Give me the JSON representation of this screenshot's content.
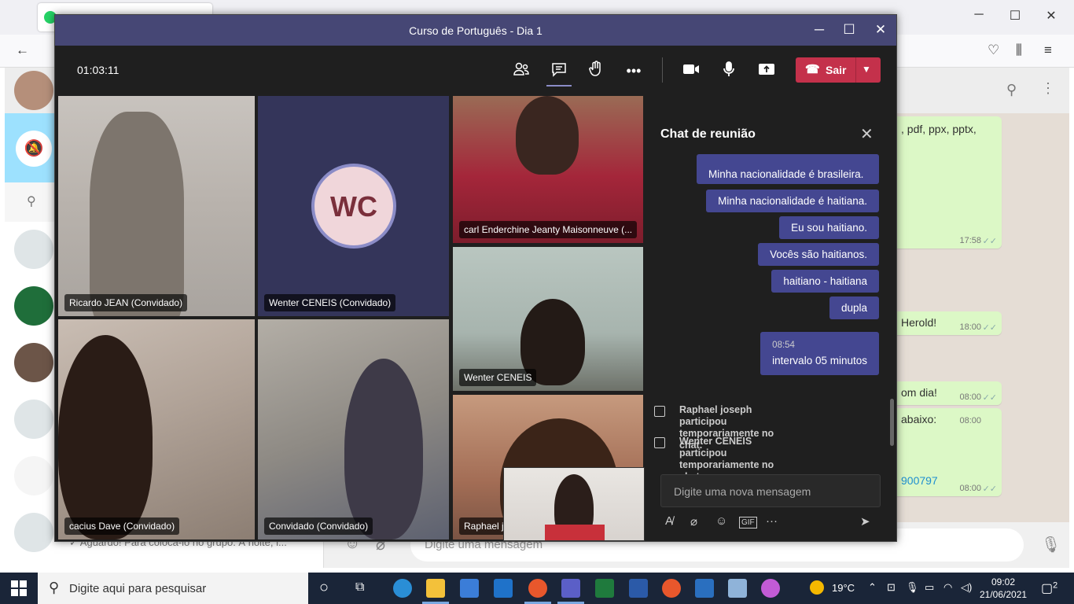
{
  "browser": {
    "wa_last_message": "✓ Aguardo! Para colocá-lo no grupo. À noite, l...",
    "wa_input_placeholder": "Digite uma mensagem",
    "wa_bubbles": [
      {
        "text": ", pdf, ppx, pptx,",
        "time": "17:58"
      },
      {
        "text": "Herold!",
        "time": "18:00"
      },
      {
        "text": "om dia!",
        "time": "08:00"
      },
      {
        "text": "abaixo:",
        "time": "08:00"
      },
      {
        "text": "900797",
        "time": "08:00"
      }
    ]
  },
  "teams": {
    "window_title": "Curso de Português - Dia 1",
    "timer": "01:03:11",
    "leave_label": "Sair",
    "participants": [
      {
        "name": "Ricardo JEAN (Convidado)"
      },
      {
        "name": "Wenter CENEIS (Convidado)",
        "initials": "WC"
      },
      {
        "name": "carl Enderchine Jeanty Maisonneuve (..."
      },
      {
        "name": "Wenter CENEIS"
      },
      {
        "name": "Raphael jo"
      },
      {
        "name": "cacius Dave (Convidado)"
      },
      {
        "name": "Convidado (Convidado)"
      }
    ],
    "chat": {
      "title": "Chat de reunião",
      "messages": [
        "Minha nacionalidade é brasileira.",
        "Minha nacionalidade é haitiana.",
        "Eu sou haitiano.",
        "Vocês são haitianos.",
        "haitiano - haitiana",
        "dupla"
      ],
      "timed_message": {
        "time": "08:54",
        "text": "intervalo 05 minutos"
      },
      "system": [
        "Raphael joseph participou temporariamente no chat.",
        "Wenter CENEIS participou temporariamente no chat."
      ],
      "compose_placeholder": "Digite uma nova mensagem"
    }
  },
  "taskbar": {
    "search_placeholder": "Digite aqui para pesquisar",
    "temperature": "19°C",
    "time": "09:02",
    "date": "21/06/2021",
    "notifications": "2"
  }
}
